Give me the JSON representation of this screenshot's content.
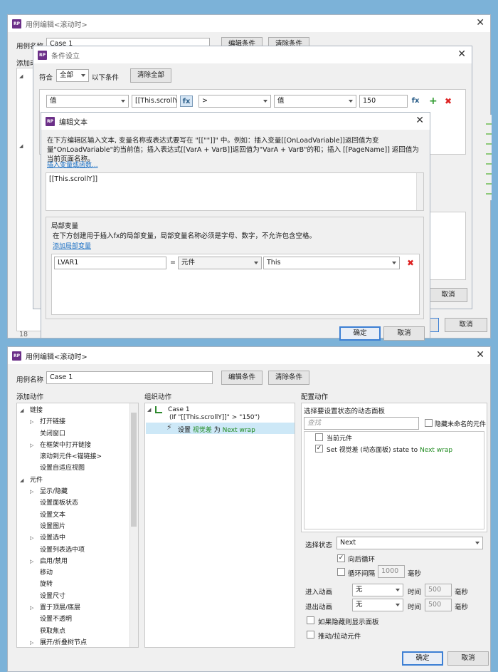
{
  "bg_window": {
    "title": "用例编辑<滚动时>",
    "case_label": "用例名称",
    "case_value": "Case 1",
    "edit_condition": "编辑条件",
    "clear_condition": "清除条件",
    "add_action_stub": "添加动",
    "cancel": "取消",
    "numbers": [
      "18",
      "18"
    ]
  },
  "condition_dialog": {
    "title": "条件设立",
    "match_label": "符合",
    "match_value": "全部",
    "following": "以下条件",
    "clear_all": "清除全部",
    "row": {
      "type": "值",
      "expr": "[[This.scrollY]]",
      "operator": ">",
      "value_type": "值",
      "value": "150"
    },
    "cancel": "取消",
    "fx": "fx"
  },
  "edit_text_dialog": {
    "title": "编辑文本",
    "description": "在下方编辑区输入文本, 变量名称或表达式要写在 \"[[\"\"]]\" 中。例如：插入变量[[OnLoadVariable]]返回值为变量\"OnLoadVariable\"的当前值；插入表达式[[VarA + VarB]]返回值为\"VarA + VarB\"的和；插入 [[PageName]] 返回值为当前页面名称。",
    "insert_link": "插入变量或函数...",
    "text_content": "[[This.scrollY]]",
    "local_vars_title": "局部变量",
    "local_vars_desc": "在下方创建用于插入fx的局部变量，局部变量名称必须是字母、数字，不允许包含空格。",
    "add_local_link": "添加局部变量",
    "var_row": {
      "name": "LVAR1",
      "eq": "=",
      "type": "元件",
      "value": "This"
    },
    "ok": "确定",
    "cancel": "取消"
  },
  "main_window": {
    "title": "用例编辑<滚动时>",
    "case_label": "用例名称",
    "case_value": "Case 1",
    "edit_condition": "编辑条件",
    "clear_condition": "清除条件",
    "add_actions": {
      "title": "添加动作",
      "tree": [
        {
          "label": "链接",
          "level": 0,
          "toggle": "open"
        },
        {
          "label": "打开链接",
          "level": 1,
          "toggle": "closed"
        },
        {
          "label": "关闭窗口",
          "level": 1,
          "toggle": "none"
        },
        {
          "label": "在框架中打开链接",
          "level": 1,
          "toggle": "closed"
        },
        {
          "label": "滚动到元件<锚链接>",
          "level": 1,
          "toggle": "none"
        },
        {
          "label": "设置自适应视图",
          "level": 1,
          "toggle": "none"
        },
        {
          "label": "元件",
          "level": 0,
          "toggle": "open"
        },
        {
          "label": "显示/隐藏",
          "level": 1,
          "toggle": "closed"
        },
        {
          "label": "设置面板状态",
          "level": 1,
          "toggle": "none"
        },
        {
          "label": "设置文本",
          "level": 1,
          "toggle": "none"
        },
        {
          "label": "设置图片",
          "level": 1,
          "toggle": "none"
        },
        {
          "label": "设置选中",
          "level": 1,
          "toggle": "closed"
        },
        {
          "label": "设置列表选中项",
          "level": 1,
          "toggle": "none"
        },
        {
          "label": "启用/禁用",
          "level": 1,
          "toggle": "closed"
        },
        {
          "label": "移动",
          "level": 1,
          "toggle": "none"
        },
        {
          "label": "旋转",
          "level": 1,
          "toggle": "none"
        },
        {
          "label": "设置尺寸",
          "level": 1,
          "toggle": "none"
        },
        {
          "label": "置于顶层/底层",
          "level": 1,
          "toggle": "closed"
        },
        {
          "label": "设置不透明",
          "level": 1,
          "toggle": "none"
        },
        {
          "label": "获取焦点",
          "level": 1,
          "toggle": "none"
        },
        {
          "label": "展开/折叠树节点",
          "level": 1,
          "toggle": "closed"
        }
      ]
    },
    "organize": {
      "title": "组织动作",
      "case_name": "Case 1",
      "case_condition": "(If \"[[This.scrollY]]\" > \"150\")",
      "action_prefix": "设置",
      "action_target": "视觉差",
      "action_mid": "为",
      "action_state": "Next wrap"
    },
    "configure": {
      "title": "配置动作",
      "choose_label": "选择要设置状态的动态面板",
      "search_placeholder": "查找",
      "hide_unnamed": "隐藏未命名的元件",
      "list": [
        {
          "label": "当前元件",
          "checked": false
        },
        {
          "prefix": "Set 视觉差 (动态面板) state to",
          "state": "Next wrap",
          "checked": true
        }
      ],
      "select_state_label": "选择状态",
      "select_state_value": "Next",
      "loop_back": "向后循环",
      "loop_interval": "循环间隔",
      "interval_value": "1000",
      "ms": "毫秒",
      "enter_anim": "进入动画",
      "exit_anim": "退出动画",
      "anim_none": "无",
      "time": "时间",
      "time_value": "500",
      "show_if_hidden": "如果隐藏则显示面板",
      "push_pull": "推动/拉动元件"
    },
    "ok": "确定",
    "cancel": "取消"
  }
}
